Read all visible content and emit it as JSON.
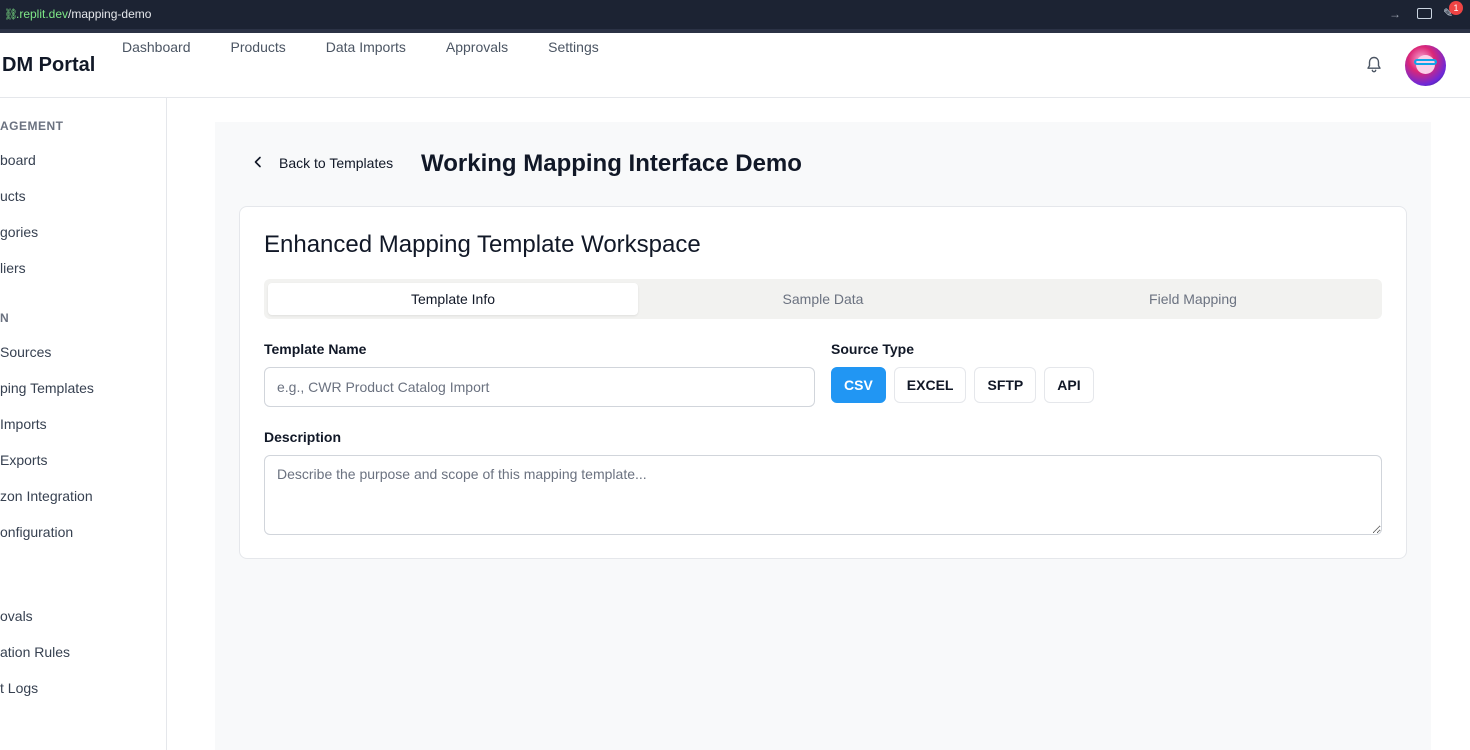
{
  "browser": {
    "url_host": ".replit.dev",
    "url_path": "/mapping-demo",
    "notification_count": "1"
  },
  "header": {
    "brand": "DM Portal",
    "nav": [
      "Dashboard",
      "Products",
      "Data Imports",
      "Approvals",
      "Settings"
    ]
  },
  "sidebar": {
    "sections": [
      {
        "heading": "AGEMENT",
        "items": [
          "board",
          "ucts",
          "gories",
          "liers"
        ]
      },
      {
        "heading": "N",
        "items": [
          "Sources",
          "ping Templates",
          "Imports",
          "Exports",
          "zon Integration",
          "onfiguration"
        ]
      },
      {
        "heading": "",
        "items": [
          "ovals",
          "ation Rules",
          "t Logs"
        ]
      }
    ]
  },
  "page": {
    "back_label": "Back to Templates",
    "title": "Working Mapping Interface Demo"
  },
  "workspace": {
    "title": "Enhanced Mapping Template Workspace",
    "tabs": [
      "Template Info",
      "Sample Data",
      "Field Mapping"
    ],
    "active_tab": "Template Info",
    "template_name": {
      "label": "Template Name",
      "placeholder": "e.g., CWR Product Catalog Import",
      "value": ""
    },
    "source_type": {
      "label": "Source Type",
      "options": [
        "CSV",
        "EXCEL",
        "SFTP",
        "API"
      ],
      "selected": "CSV"
    },
    "description": {
      "label": "Description",
      "placeholder": "Describe the purpose and scope of this mapping template...",
      "value": ""
    }
  },
  "colors": {
    "accent": "#2196f3",
    "badge": "#ef4444"
  }
}
